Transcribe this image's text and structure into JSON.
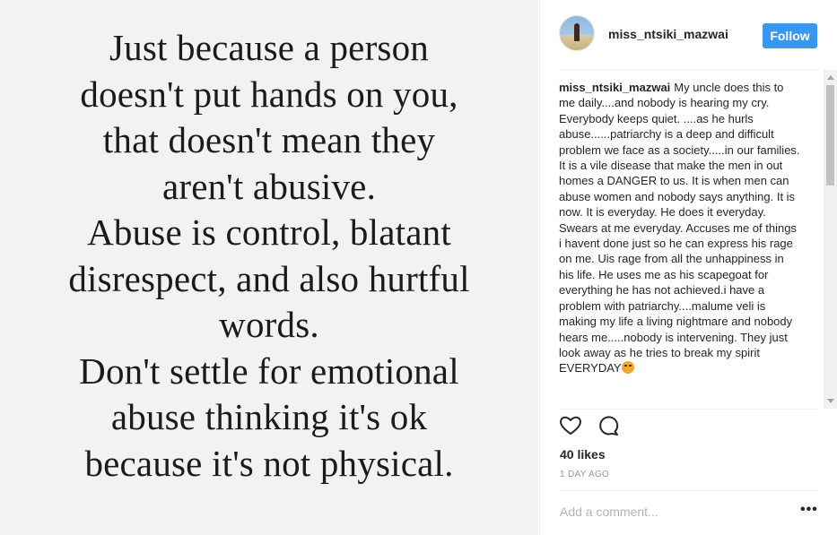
{
  "post_image": {
    "quote_lines": [
      "Just because a person",
      "doesn't put hands on you,",
      "that doesn't mean they",
      "aren't abusive.",
      "Abuse is control, blatant",
      "disrespect, and also hurtful",
      "words.",
      "Don't settle for emotional",
      "abuse thinking it's ok",
      "because it's not physical."
    ]
  },
  "header": {
    "username": "miss_ntsiki_mazwai",
    "follow_label": "Follow"
  },
  "caption": {
    "username": "miss_ntsiki_mazwai",
    "text": "My uncle does this to me daily....and nobody is hearing my cry. Everybody keeps quiet. ....as he hurls abuse......patriarchy is a deep and difficult problem we face as a society.....in our families. It is a vile disease that make the men in out homes a DANGER to us. It is when men can abuse women and nobody says anything. It is now. It is everyday. He does it everyday. Swears at me everyday. Accuses me of things i havent done just so he can express his rage on me. Uis rage from all the unhappiness in his life. He uses me as his scapegoat for everything he has not achieved.i have a problem with patriarchy....malume veli is making my life a living nightmare and nobody hears me.....nobody is intervening. They just look away as he tries to break my spirit EVERYDAY",
    "emoji_icon": "angry-face-icon"
  },
  "actions": {
    "like_icon": "heart-icon",
    "comment_icon": "comment-bubble-icon"
  },
  "likes": "40 likes",
  "timestamp": "1 DAY AGO",
  "comment": {
    "placeholder": "Add a comment...",
    "value": ""
  },
  "colors": {
    "follow_button": "#3897f0",
    "image_background": "#f2f2f2",
    "divider": "#efefef"
  }
}
